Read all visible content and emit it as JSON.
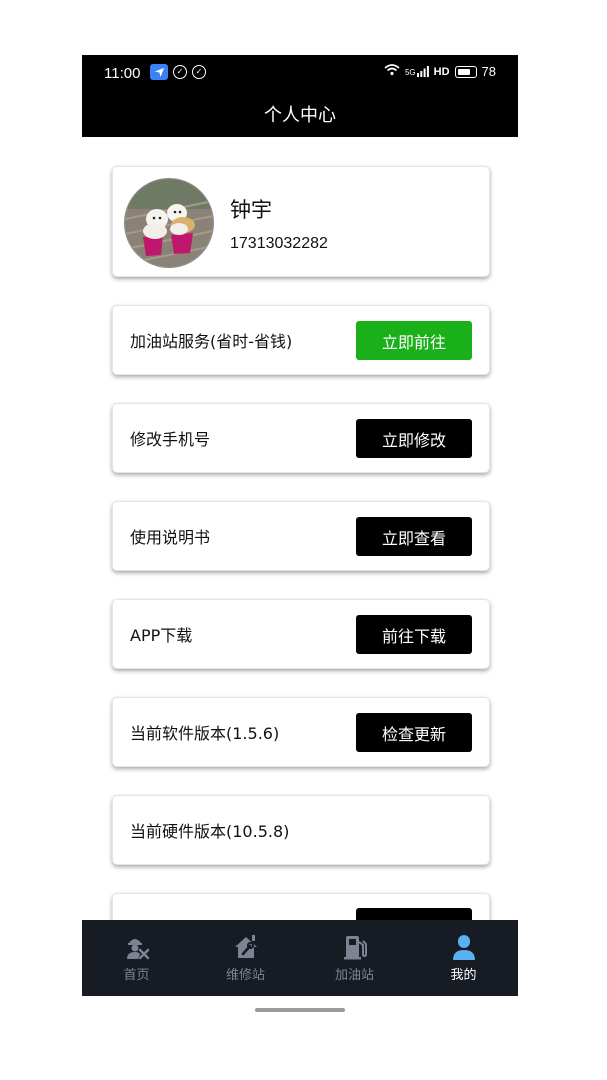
{
  "status_bar": {
    "time": "11:00",
    "network": "5G",
    "hd": "HD",
    "battery": "78"
  },
  "header": {
    "title": "个人中心"
  },
  "profile": {
    "name": "钟宇",
    "phone": "17313032282"
  },
  "rows": [
    {
      "label": "加油站服务(省时-省钱)",
      "button": "立即前往",
      "button_color": "#1ab01a"
    },
    {
      "label": "修改手机号",
      "button": "立即修改",
      "button_color": "#000000"
    },
    {
      "label": "使用说明书",
      "button": "立即查看",
      "button_color": "#000000"
    },
    {
      "label": "APP下载",
      "button": "前往下载",
      "button_color": "#000000"
    },
    {
      "label": "当前软件版本(1.5.6)",
      "button": "检查更新",
      "button_color": "#000000"
    },
    {
      "label": "当前硬件版本(10.5.8)",
      "button": null
    }
  ],
  "tabs": [
    {
      "label": "首页",
      "icon": "worker-tools-icon",
      "active": false
    },
    {
      "label": "维修站",
      "icon": "repair-house-icon",
      "active": false
    },
    {
      "label": "加油站",
      "icon": "fuel-pump-icon",
      "active": false
    },
    {
      "label": "我的",
      "icon": "user-icon",
      "active": true
    }
  ],
  "colors": {
    "accent_green": "#1ab01a",
    "tab_bar_bg": "#171b24",
    "active_icon": "#5ab0f0",
    "inactive": "#7e8391"
  }
}
